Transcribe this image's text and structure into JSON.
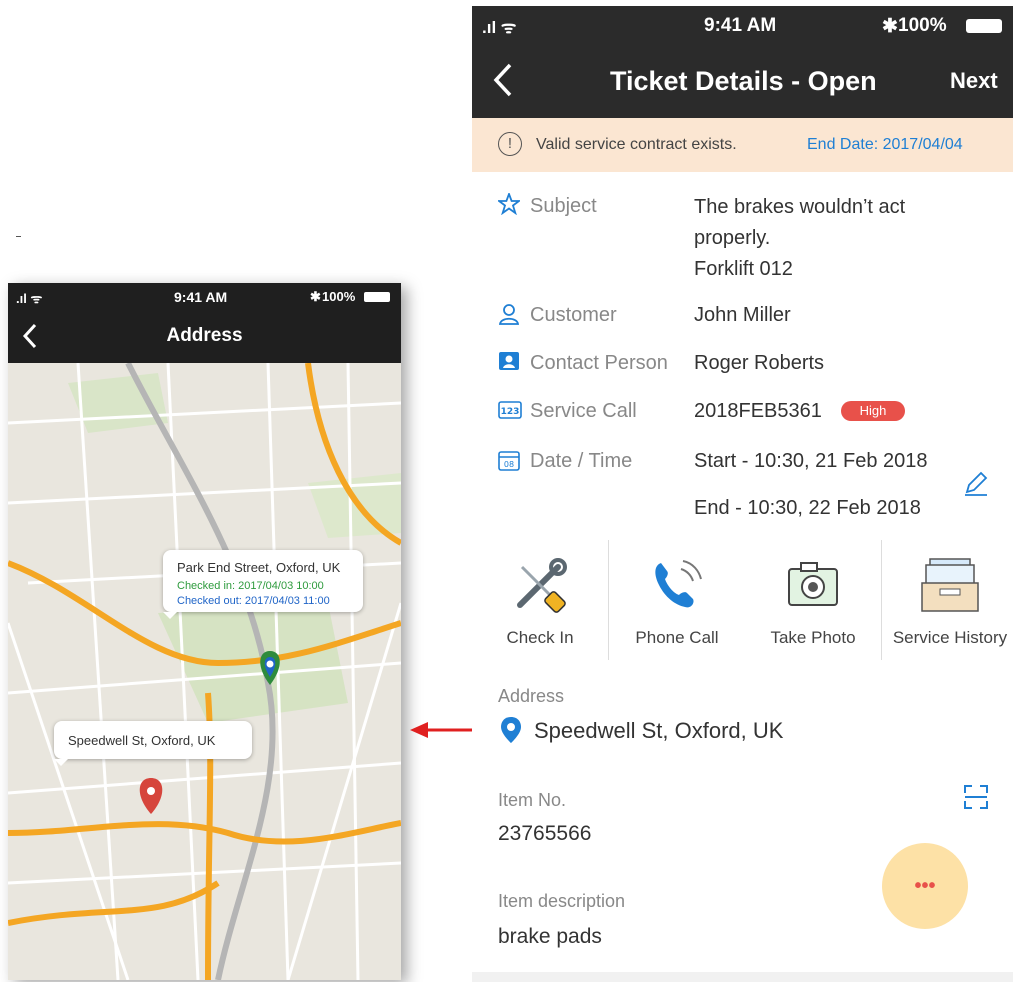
{
  "left_phone": {
    "status": {
      "time": "9:41 AM",
      "battery": "100%"
    },
    "nav": {
      "title": "Address"
    },
    "map": {
      "callout_primary": {
        "address": "Park End Street, Oxford, UK",
        "checked_in": "Checked in: 2017/04/03 10:00",
        "checked_out": "Checked out: 2017/04/03 11:00"
      },
      "callout_secondary": {
        "address": "Speedwell St, Oxford, UK"
      }
    }
  },
  "right_phone": {
    "status": {
      "time": "9:41 AM",
      "battery": "100%"
    },
    "nav": {
      "title": "Ticket Details - Open",
      "next_label": "Next"
    },
    "banner": {
      "message": "Valid service contract exists.",
      "end_date": "End Date: 2017/04/04"
    },
    "fields": {
      "subject": {
        "label": "Subject",
        "value_lines": [
          "The brakes wouldn’t act",
          "properly.",
          "Forklift 012"
        ]
      },
      "customer": {
        "label": "Customer",
        "value": "John Miller"
      },
      "contact": {
        "label": "Contact Person",
        "value": "Roger Roberts"
      },
      "service_call": {
        "label": "Service Call",
        "value": "2018FEB5361",
        "priority": "High"
      },
      "datetime": {
        "label": "Date / Time",
        "start": "Start - 10:30, 21 Feb 2018",
        "end": "End - 10:30, 22 Feb 2018"
      }
    },
    "actions": [
      {
        "label": "Check In",
        "icon": "tools-icon"
      },
      {
        "label": "Phone Call",
        "icon": "phone-icon"
      },
      {
        "label": "Take Photo",
        "icon": "camera-icon"
      },
      {
        "label": "Service History",
        "icon": "history-tray-icon"
      }
    ],
    "address": {
      "label": "Address",
      "value": "Speedwell St, Oxford, UK"
    },
    "item_no": {
      "label": "Item No.",
      "value": "23765566"
    },
    "item_description": {
      "label": "Item description",
      "value": "brake pads"
    },
    "fab": {
      "label": "•••"
    }
  },
  "colors": {
    "nav_bg": "#2b2b2b",
    "banner_bg": "#fbe6d2",
    "accent_blue": "#1f7fd4",
    "priority_red": "#e8514a",
    "fab_bg": "#fde1a6",
    "map_road": "#f4a623"
  }
}
